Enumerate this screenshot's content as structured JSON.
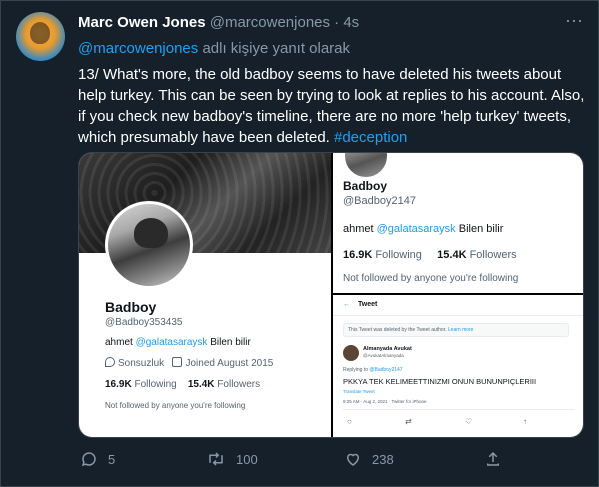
{
  "tweet": {
    "name": "Marc Owen Jones",
    "handle": "@marcowenjones",
    "dot": "·",
    "time": "4s",
    "reply_mention": "@marcowenjones",
    "reply_suffix": " adlı kişiye yanıt olarak",
    "text": "13/ What's more, the old badboy seems to have deleted his tweets about help turkey. This can be seen by trying to look at replies to his account. Also, if you check new badboy's timeline, there are no more 'help turkey' tweets, which presumably have been deleted. ",
    "hashtag": "#deception",
    "more_icon": "···"
  },
  "left_profile": {
    "name": "Badboy",
    "handle": "@Badboy353435",
    "bio_prefix": "ahmet ",
    "bio_mention": "@galatasaraysk",
    "bio_suffix": " Bilen bilir",
    "location": "Sonsuzluk",
    "joined": "Joined August 2015",
    "following_count": "16.9K",
    "following_label": " Following",
    "followers_count": "15.4K",
    "followers_label": " Followers",
    "not_followed": "Not followed by anyone you're following"
  },
  "right_profile": {
    "name": "Badboy",
    "handle": "@Badboy2147",
    "bio_prefix": "ahmet ",
    "bio_mention": "@galatasaraysk",
    "bio_suffix": " Bilen bilir",
    "following_count": "16.9K",
    "following_label": " Following",
    "followers_count": "15.4K",
    "followers_label": " Followers",
    "not_followed": "Not followed by anyone you're following"
  },
  "deleted_tweet_view": {
    "back_icon": "←",
    "title": "Tweet",
    "deleted_notice": "This Tweet was deleted by the Tweet author. ",
    "learn_more": "Learn more",
    "author_name": "Almanyada Avukat",
    "author_handle": "@AvukatAlmanyada",
    "replying_prefix": "Replying to ",
    "replying_mention": "@Badboy2147",
    "text": "PKKYA TEK KELIMEETTINIZMI ONUN BUNUNPIÇLERIII",
    "translate": "Translate Tweet",
    "timestamp": "9:25 AM · Aug 2, 2021 · Twitter for iPhone"
  },
  "actions": {
    "replies": "5",
    "retweets": "100",
    "likes": "238"
  },
  "colors": {
    "background": "#15202b",
    "accent": "#1da1f2",
    "muted": "#8899a6"
  }
}
